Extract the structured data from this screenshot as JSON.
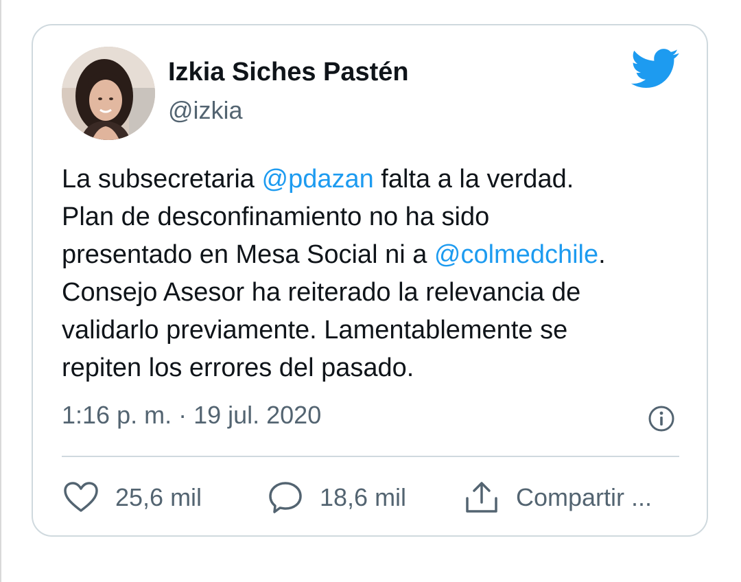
{
  "author": {
    "name": "Izkia Siches Pastén",
    "handle": "@izkia"
  },
  "tweet": {
    "lines": [
      [
        "La subsecretaria ",
        "@pdazan",
        " falta a la verdad."
      ],
      [
        "Plan de desconfinamiento no ha sido"
      ],
      [
        "presentado en Mesa Social ni a ",
        "@colmedchile",
        "."
      ],
      [
        "Consejo Asesor ha reiterado la relevancia de"
      ],
      [
        "validarlo previamente. Lamentablemente se"
      ],
      [
        "repiten los errores del pasado."
      ]
    ],
    "timestamp": "1:16 p. m. · 19 jul. 2020"
  },
  "actions": {
    "likes": "25,6 mil",
    "replies": "18,6 mil",
    "share": "Compartir ..."
  },
  "icons": {
    "logo": "twitter-bird-icon",
    "info": "info-icon",
    "like": "heart-icon",
    "reply": "speech-bubble-icon",
    "share": "share-icon"
  },
  "colors": {
    "accent": "#1d9bf0",
    "text": "#0f1419",
    "secondary": "#536471",
    "border": "#cfd9de"
  }
}
